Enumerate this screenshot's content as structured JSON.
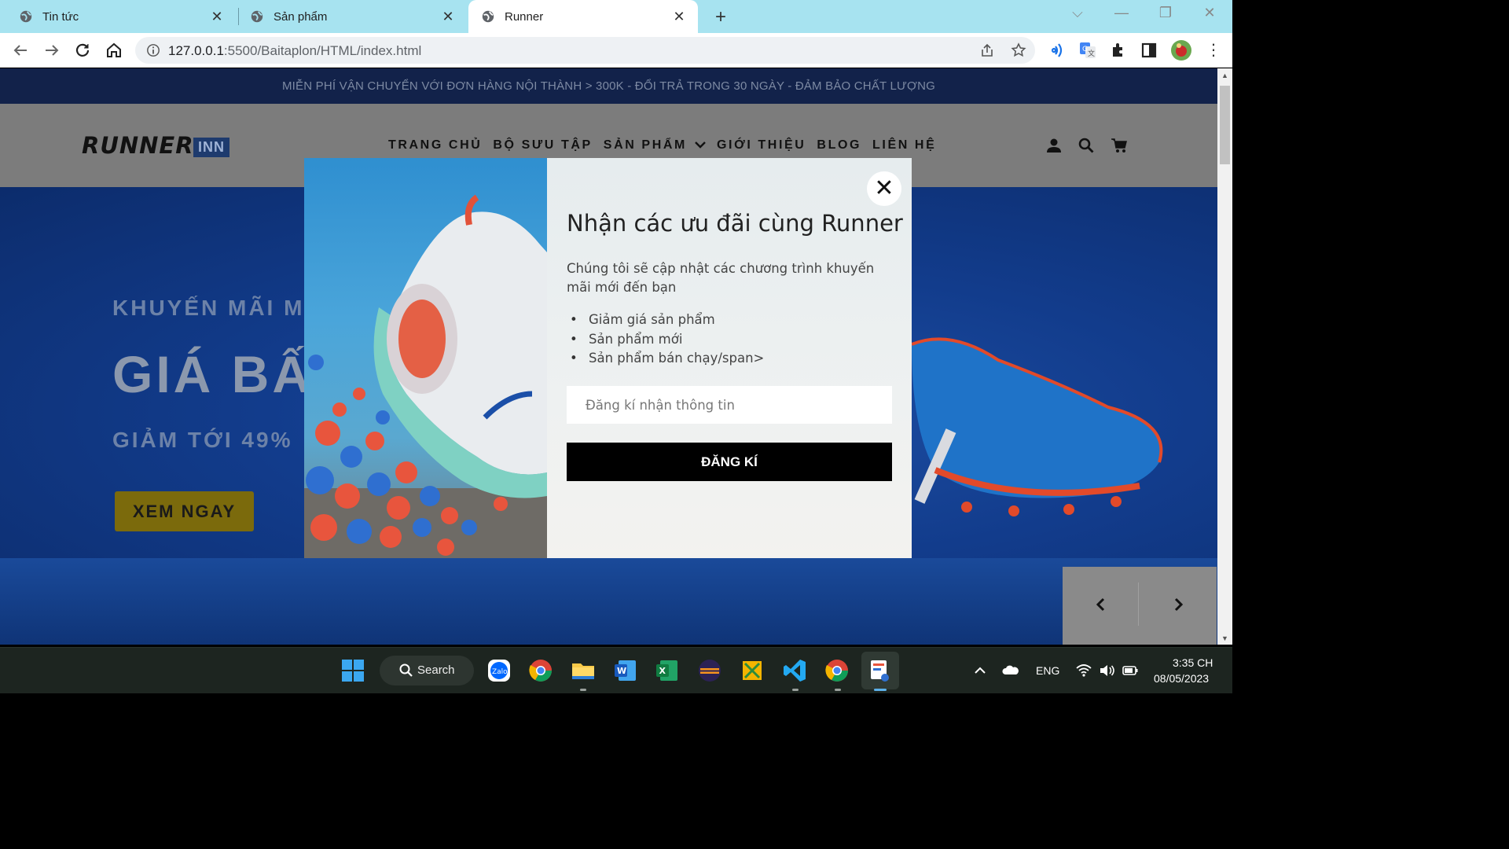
{
  "browser": {
    "tabs": [
      {
        "title": "Tin tức",
        "active": false
      },
      {
        "title": "Sản phẩm",
        "active": false
      },
      {
        "title": "Runner",
        "active": true
      }
    ],
    "url_host": "127.0.0.1",
    "url_rest": ":5500/Baitaplon/HTML/index.html"
  },
  "site": {
    "promo_bar": "MIỄN PHÍ VẬN CHUYỂN VỚI ĐƠN HÀNG NỘI THÀNH > 300K - ĐỔI TRẢ TRONG 30 NGÀY - ĐẢM BẢO CHẤT LƯỢNG",
    "logo": "RUNNER",
    "logo_badge": "INN",
    "nav": [
      "TRANG CHỦ",
      "BỘ SƯU TẬP",
      "SẢN PHẨM",
      "GIỚI THIỆU",
      "BLOG",
      "LIÊN HỆ"
    ],
    "hero": {
      "subtitle": "KHUYẾN MÃI M",
      "headline": "GIÁ BẤ",
      "discount": "GIẢM TỚI 49%",
      "cta": "XEM NGAY"
    }
  },
  "modal": {
    "title": "Nhận các ưu đãi cùng Runner",
    "description": "Chúng tôi sẽ cập nhật các chương trình khuyến mãi mới đến bạn",
    "benefits": [
      "Giảm giá sản phẩm",
      "Sản phẩm mới",
      "Sản phẩm bán chạy/span>"
    ],
    "input_placeholder": "Đăng kí nhận thông tin",
    "submit_label": "ĐĂNG KÍ",
    "close_label": "✕"
  },
  "taskbar": {
    "search_label": "Search",
    "lang": "ENG",
    "time": "3:35 CH",
    "date": "08/05/2023"
  },
  "colors": {
    "promo_bg": "#12224a",
    "header_bg": "#7c7c7c",
    "hero_bg": "#123c8c",
    "cta_bg": "#7b6a0c",
    "submit_bg": "#000000",
    "tabbar_bg": "#a7e3f0"
  }
}
